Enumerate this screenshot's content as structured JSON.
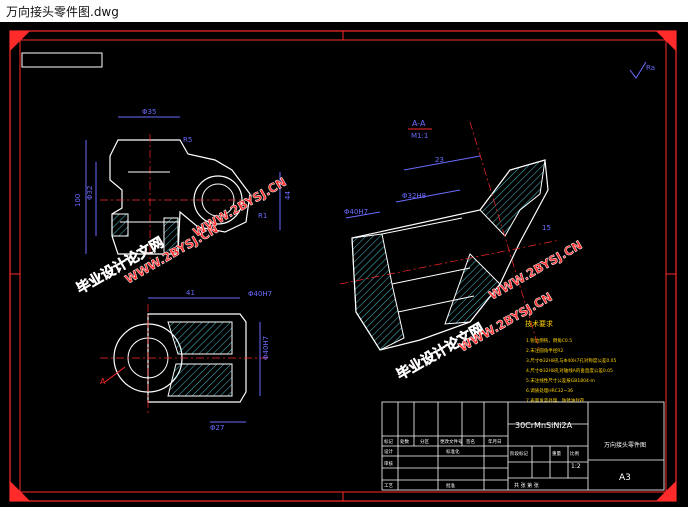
{
  "window": {
    "title": "万向接头零件图.dwg"
  },
  "drawing": {
    "section_label": "A-A",
    "section_scale": "M1:1",
    "material": "30CrMnSiNi2A",
    "part_name": "万向接头零件图",
    "sheet_size": "A3",
    "scale": "1:2",
    "roughness": "Ra",
    "tech_title": "技术要求",
    "tech_notes": [
      "1.锐边倒钝，倒角C0.5",
      "2.未注圆角半径R2",
      "3.尺寸Φ32H8孔与Φ40H7孔对称度公差0.05",
      "4.尺寸Φ32H8孔对轴线A的垂直度公差0.05",
      "5.未注线性尺寸公差按GB1804-m",
      "6.调质处理HRC32~36",
      "7.表面发蓝处理，防锈油封存"
    ],
    "watermarks": [
      "毕业设计论文网",
      "WWW.2BYSJ.CN"
    ],
    "dims": {
      "d1": "Φ35",
      "d2": "R5",
      "d3": "R1",
      "d4": "Φ40H7",
      "d5": "Φ32",
      "d6": "44",
      "d7": "100",
      "d8": "41",
      "d9": "Φ27",
      "d10": "Φ40H7",
      "d11": "A",
      "d12": "15",
      "d13": "23",
      "d14": "Φ32H8",
      "d15": "Φ40H7"
    },
    "title_block": {
      "row_labels": [
        "标记",
        "处数",
        "分区",
        "更改文件号",
        "签名",
        "年月日"
      ],
      "design": "设计",
      "standard": "标准化",
      "check": "审核",
      "process": "工艺",
      "approve": "批准",
      "stage": "阶段标记",
      "weight": "重量",
      "ratio": "比例",
      "sheets": "共 张 第 张"
    }
  }
}
